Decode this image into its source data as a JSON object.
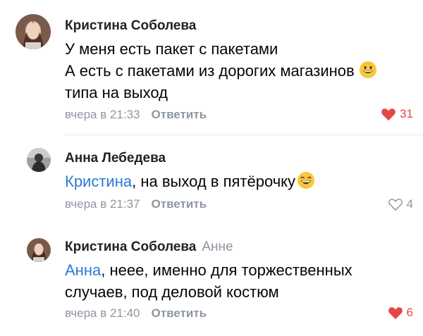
{
  "comments": [
    {
      "author": "Кристина Соболева",
      "reply_to": "",
      "mention": "",
      "lines": [
        "У меня есть пакет с пакетами",
        "А есть с пакетами из дорогих магазинов",
        "типа на выход"
      ],
      "time": "вчера в 21:33",
      "reply_label": "Ответить",
      "likes": "31",
      "liked": true
    },
    {
      "author": "Анна Лебедева",
      "reply_to": "",
      "mention": "Кристина",
      "lines": [
        ", на выход в пятёрочку"
      ],
      "time": "вчера в 21:37",
      "reply_label": "Ответить",
      "likes": "4",
      "liked": false
    },
    {
      "author": "Кристина Соболева",
      "reply_to": "Анне",
      "mention": "Анна",
      "lines": [
        ", неее, именно для торжественных",
        "случаев, под деловой костюм"
      ],
      "time": "вчера в 21:40",
      "reply_label": "Ответить",
      "likes": "6",
      "liked": true
    }
  ],
  "colors": {
    "like_active": "#e64646",
    "mention": "#2a7bd4",
    "muted": "#8d96a1"
  },
  "icons": [
    "avatar-photo",
    "grinning-emoji-icon",
    "heart-filled-icon",
    "heart-outline-icon"
  ]
}
